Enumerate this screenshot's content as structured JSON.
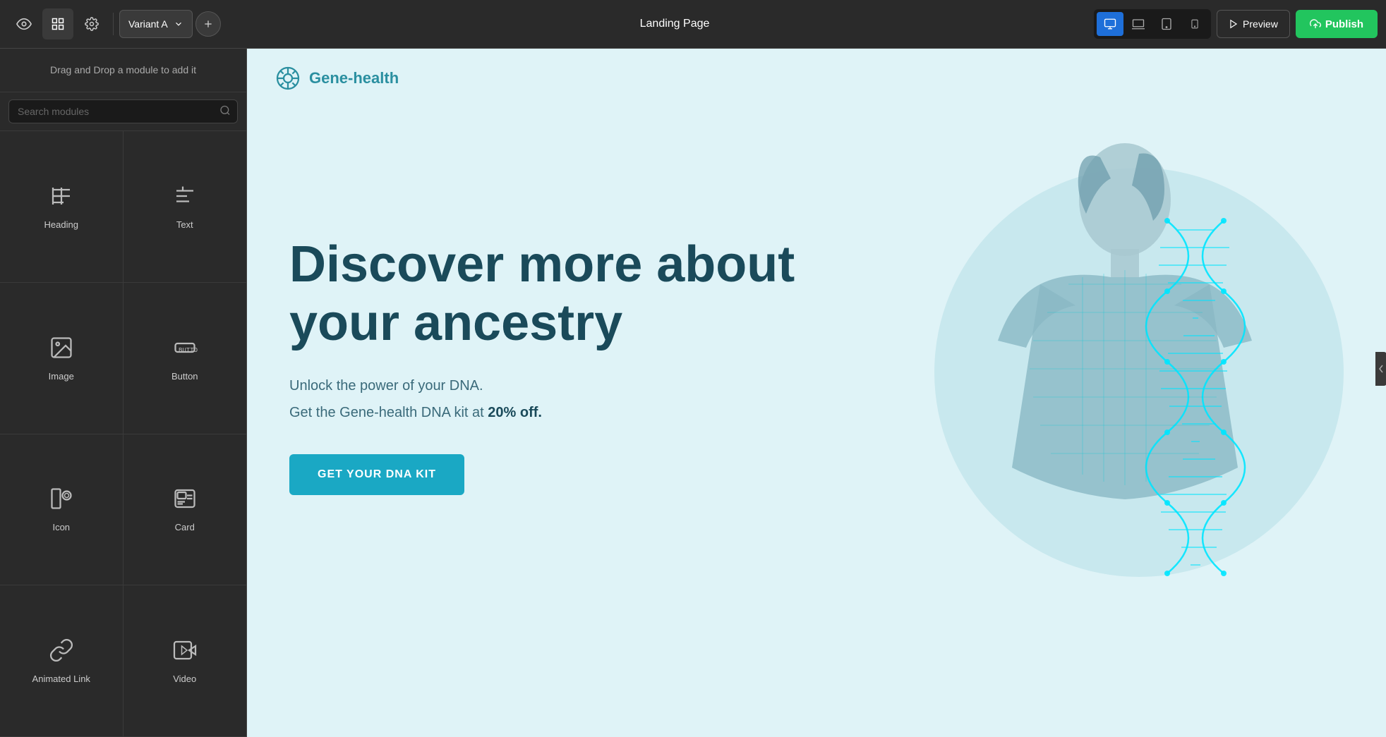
{
  "toolbar": {
    "variant_label": "Variant A",
    "page_title": "Landing Page",
    "preview_label": "Preview",
    "publish_label": "Publish",
    "add_tooltip": "Add variant"
  },
  "sidebar": {
    "drag_hint": "Drag and Drop a module to add it",
    "search_placeholder": "Search modules",
    "modules": [
      {
        "id": "heading",
        "label": "Heading",
        "icon": "heading"
      },
      {
        "id": "text",
        "label": "Text",
        "icon": "text"
      },
      {
        "id": "image",
        "label": "Image",
        "icon": "image"
      },
      {
        "id": "button",
        "label": "Button",
        "icon": "button"
      },
      {
        "id": "icon",
        "label": "Icon",
        "icon": "icon"
      },
      {
        "id": "card",
        "label": "Card",
        "icon": "card"
      },
      {
        "id": "animated-link",
        "label": "Animated Link",
        "icon": "link"
      },
      {
        "id": "video",
        "label": "Video",
        "icon": "video"
      }
    ]
  },
  "landing_page": {
    "logo_text": "Gene-health",
    "hero_title": "Discover more about your ancestry",
    "hero_subtitle1": "Unlock the power of your DNA.",
    "hero_subtitle2": "Get the Gene-health DNA kit at",
    "hero_discount": "20% off.",
    "cta_label": "GET YOUR DNA KIT"
  },
  "colors": {
    "publish_green": "#22c55e",
    "active_blue": "#1e6fd9",
    "hero_bg": "#dff3f7",
    "circle_bg": "#c8e8ee",
    "title_color": "#1a4a5a",
    "subtitle_color": "#3a6a7a",
    "cta_bg": "#1aa8c4",
    "logo_color": "#2a8fa0"
  }
}
